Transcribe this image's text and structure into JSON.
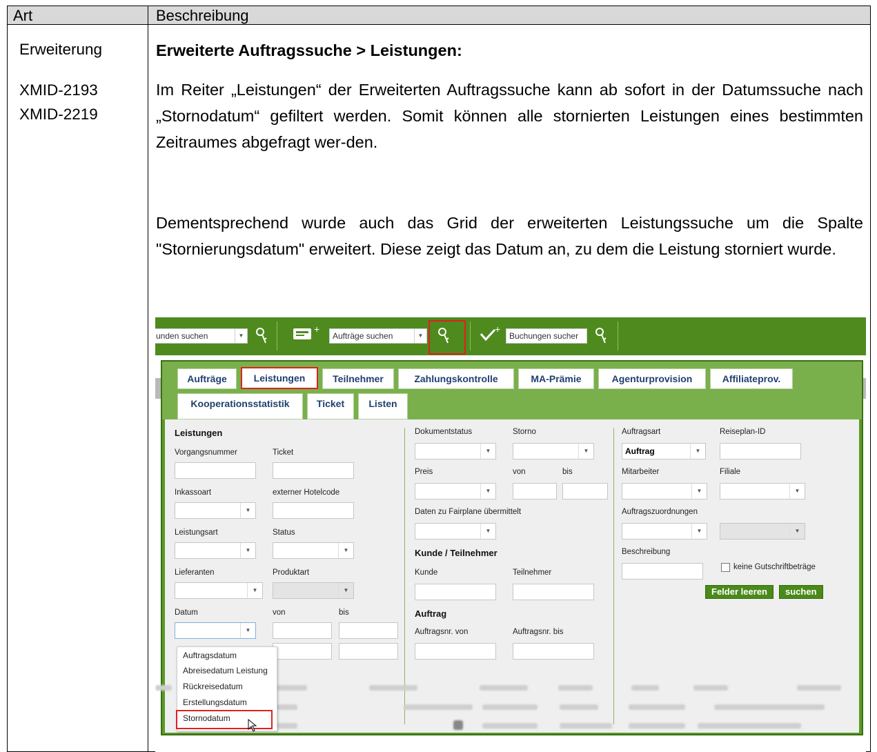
{
  "table": {
    "header_art": "Art",
    "header_desc": "Beschreibung",
    "type_value": "Erweiterung",
    "ids": [
      "XMID-2193",
      "XMID-2219"
    ],
    "title": "Erweiterte Auftragssuche > Leistungen:",
    "para1": "Im Reiter „Leistungen“ der Erweiterten Auftragssuche kann ab sofort in der Datumssuche nach „Stornodatum“ gefiltert werden. Somit können alle stornierten Leistungen eines bestimmten Zeitraumes abgefragt wer-den.",
    "para2": "Dementsprechend wurde auch das Grid der erweiterten Leistungssuche um die Spalte \"Stornierungsdatum\" erweitert. Diese zeigt das Datum an, zu dem die Leistung storniert wurde."
  },
  "screenshot": {
    "toolbar": {
      "kunden_search": "unden suchen",
      "auftraege_search": "Aufträge suchen",
      "buchungen_search": "Buchungen sucher"
    },
    "tabs_row1": [
      "Aufträge",
      "Leistungen",
      "Teilnehmer",
      "Zahlungskontrolle",
      "MA-Prämie",
      "Agenturprovision",
      "Affiliateprov."
    ],
    "tabs_row2": [
      "Kooperationsstatistik",
      "Ticket",
      "Listen"
    ],
    "active_tab": "Leistungen",
    "col1": {
      "section": "Leistungen",
      "vorgangsnummer": "Vorgangsnummer",
      "ticket": "Ticket",
      "inkassoart": "Inkassoart",
      "ext_hotelcode": "externer Hotelcode",
      "leistungsart": "Leistungsart",
      "status": "Status",
      "lieferanten": "Lieferanten",
      "produktart": "Produktart",
      "datum": "Datum",
      "von": "von",
      "bis": "bis"
    },
    "col2": {
      "dokumentstatus": "Dokumentstatus",
      "storno": "Storno",
      "preis": "Preis",
      "von": "von",
      "bis": "bis",
      "fairplane": "Daten zu Fairplane übermittelt",
      "section_kunde": "Kunde / Teilnehmer",
      "kunde": "Kunde",
      "teilnehmer": "Teilnehmer",
      "section_auftrag": "Auftrag",
      "auftragsnr_von": "Auftragsnr. von",
      "auftragsnr_bis": "Auftragsnr. bis"
    },
    "col3": {
      "auftragsart": "Auftragsart",
      "auftragsart_value": "Auftrag",
      "reiseplan_id": "Reiseplan-ID",
      "mitarbeiter": "Mitarbeiter",
      "filiale": "Filiale",
      "auftragszuordnungen": "Auftragszuordnungen",
      "beschreibung": "Beschreibung",
      "keine_gutschrift": "keine Gutschriftbeträge",
      "btn_clear": "Felder leeren",
      "btn_search": "suchen"
    },
    "date_dropdown": [
      "Auftragsdatum",
      "Abreisedatum Leistung",
      "Rückreisedatum",
      "Erstellungsdatum",
      "Stornodatum"
    ],
    "highlight_color": "#e02020",
    "accent_green": "#4e8a1e"
  }
}
